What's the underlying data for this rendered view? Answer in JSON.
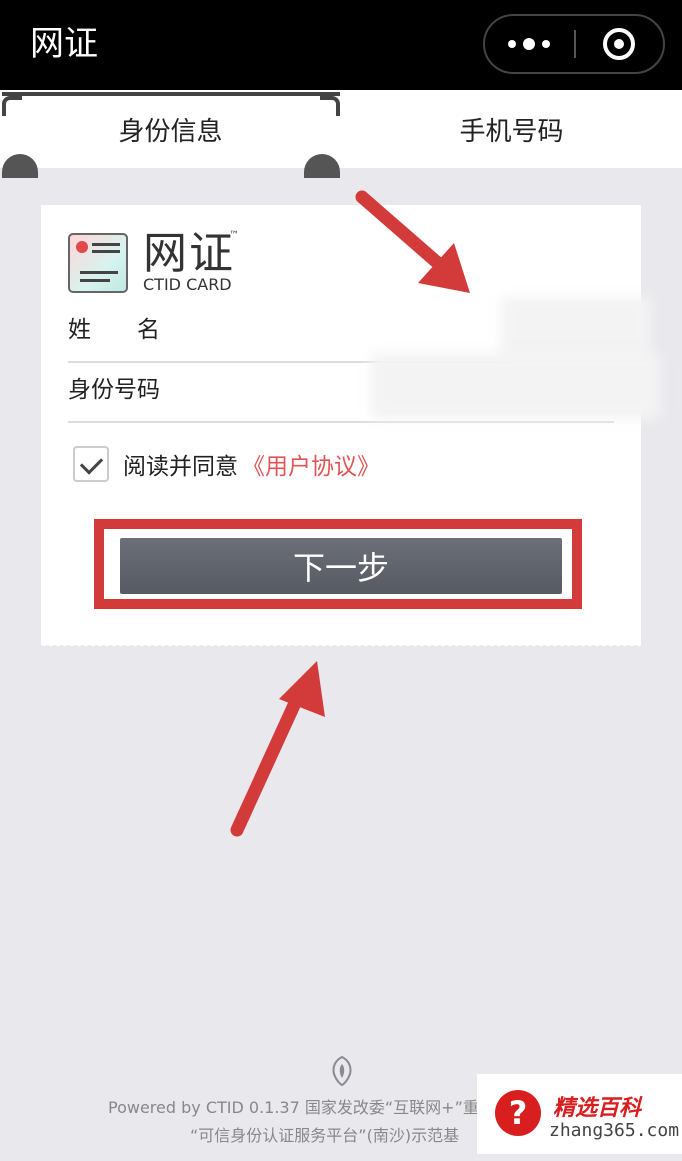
{
  "app": {
    "title": "网证"
  },
  "tabs": [
    {
      "label": "身份信息",
      "active": true
    },
    {
      "label": "手机号码",
      "active": false
    }
  ],
  "card": {
    "logo_name": "网证",
    "logo_tm": "™",
    "logo_sub": "CTID CARD",
    "fields": [
      {
        "label": "姓　　名",
        "value": ""
      },
      {
        "label": "身份号码",
        "value": ""
      }
    ],
    "agree_text": "阅读并同意",
    "agree_link": "《用户协议》",
    "agree_checked": true,
    "next_button": "下一步"
  },
  "footer": {
    "line1": "Powered by CTID 0.1.37 国家发改委“互联网+”重",
    "line2": "“可信身份认证服务平台”(南沙)示范基"
  },
  "watermark": {
    "badge": "?",
    "title": "精选百科",
    "url": "zhang365.com"
  },
  "colors": {
    "topbar": "#000000",
    "accent_red": "#d33a3a",
    "link_red": "#e05656",
    "button_gray": "#5f6269",
    "background": "#e9e9ed"
  }
}
